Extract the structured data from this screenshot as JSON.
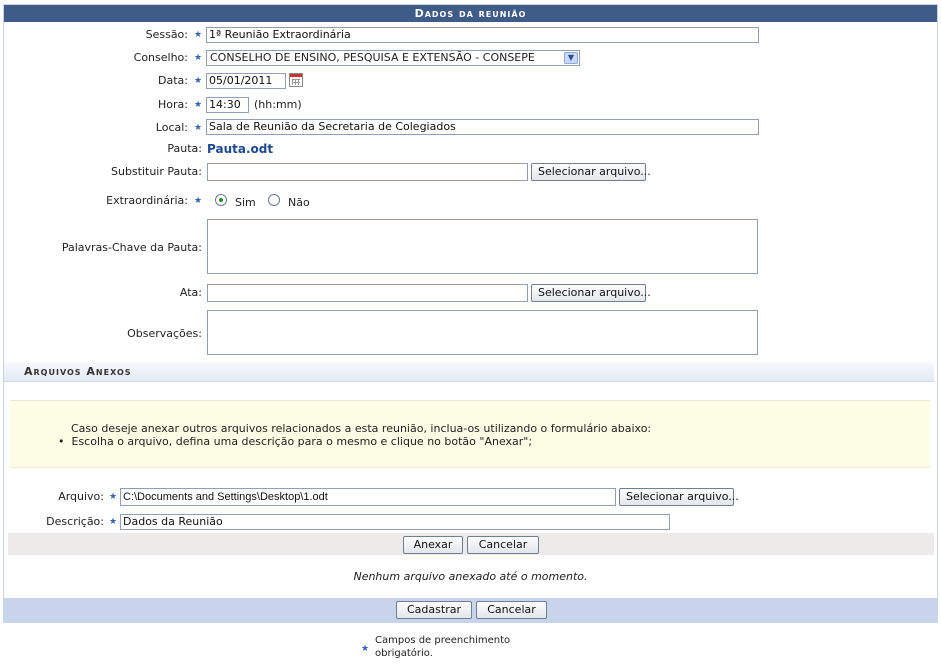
{
  "panel_title": "Dados da reunião",
  "form": {
    "sessao_label": "Sessão:",
    "sessao_value": "1ª Reunião Extraordinária",
    "conselho_label": "Conselho:",
    "conselho_value": "CONSELHO DE ENSINO, PESQUISA E EXTENSÃO - CONSEPE",
    "data_label": "Data:",
    "data_value": "05/01/2011",
    "hora_label": "Hora:",
    "hora_value": "14:30",
    "hora_hint": "(hh:mm)",
    "local_label": "Local:",
    "local_value": "Sala de Reunião da Secretaria de Colegiados",
    "pauta_label": "Pauta:",
    "pauta_link": "Pauta.odt",
    "substituir_label": "Substituir Pauta:",
    "select_file_label": "Selecionar arquivo...",
    "extra_label": "Extraordinária:",
    "sim_label": "Sim",
    "nao_label": "Não",
    "palavras_label": "Palavras-Chave da Pauta:",
    "ata_label": "Ata:",
    "obs_label": "Observações:"
  },
  "anexos": {
    "section_title": "Arquivos Anexos",
    "info_line1": "Caso deseje anexar outros arquivos relacionados a esta reunião, inclua-os utilizando o formulário abaixo:",
    "info_bullet": "Escolha o arquivo, defina uma descrição para o mesmo e clique no botão \"Anexar\";",
    "arquivo_label": "Arquivo:",
    "arquivo_value": "C:\\Documents and Settings\\Desktop\\1.odt",
    "select_file_label": "Selecionar arquivo...",
    "descricao_label": "Descrição:",
    "descricao_value": "Dados da Reunião",
    "anexar_label": "Anexar",
    "cancelar_label": "Cancelar",
    "empty_message": "Nenhum arquivo anexado até o momento."
  },
  "footer": {
    "cadastrar_label": "Cadastrar",
    "cancelar_label": "Cancelar"
  },
  "legend": {
    "text_line1": "Campos de preenchimento",
    "text_line2": "obrigatório."
  }
}
